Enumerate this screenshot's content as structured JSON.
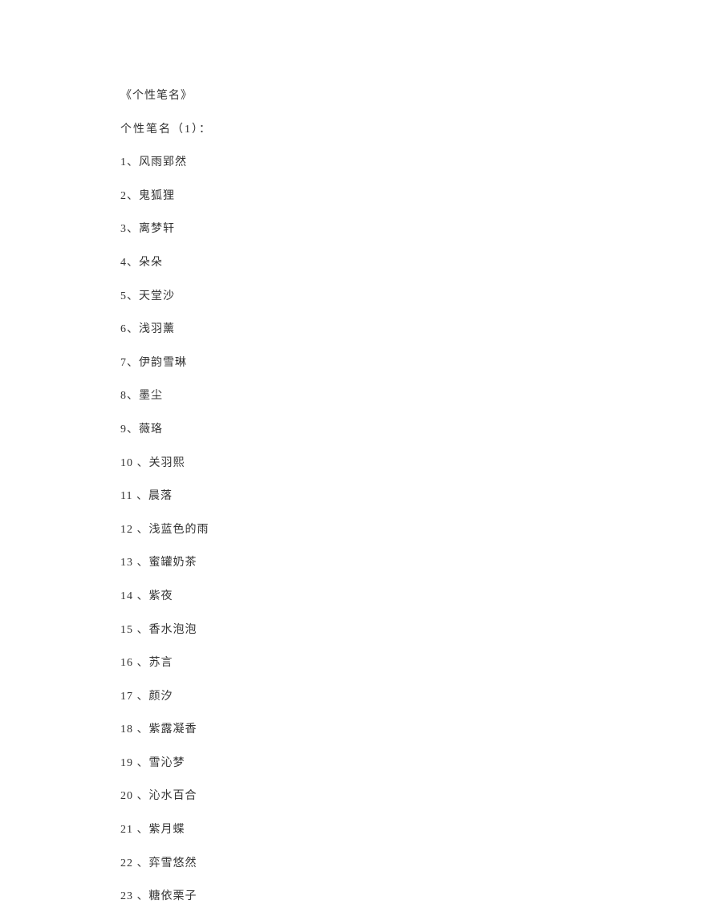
{
  "title": "《个性笔名》",
  "subtitle": "个性笔名（1）：",
  "items": [
    "1、风雨郢然",
    "2、鬼狐狸",
    "3、离梦轩",
    "4、朵朵",
    "5、天堂沙",
    "6、浅羽薰",
    "7、伊韵雪琳",
    "8、墨尘",
    "9、薇珞",
    "10 、关羽熙",
    "11 、晨落",
    "12 、浅蓝色的雨",
    "13 、蜜罐奶茶",
    "14 、紫夜",
    "15 、香水泡泡",
    "16 、苏言",
    "17 、颜汐",
    "18 、紫露凝香",
    "19 、雪沁梦",
    "20 、沁水百合",
    "21 、紫月蝶",
    "22 、弈雪悠然",
    "23 、糖依栗子"
  ]
}
